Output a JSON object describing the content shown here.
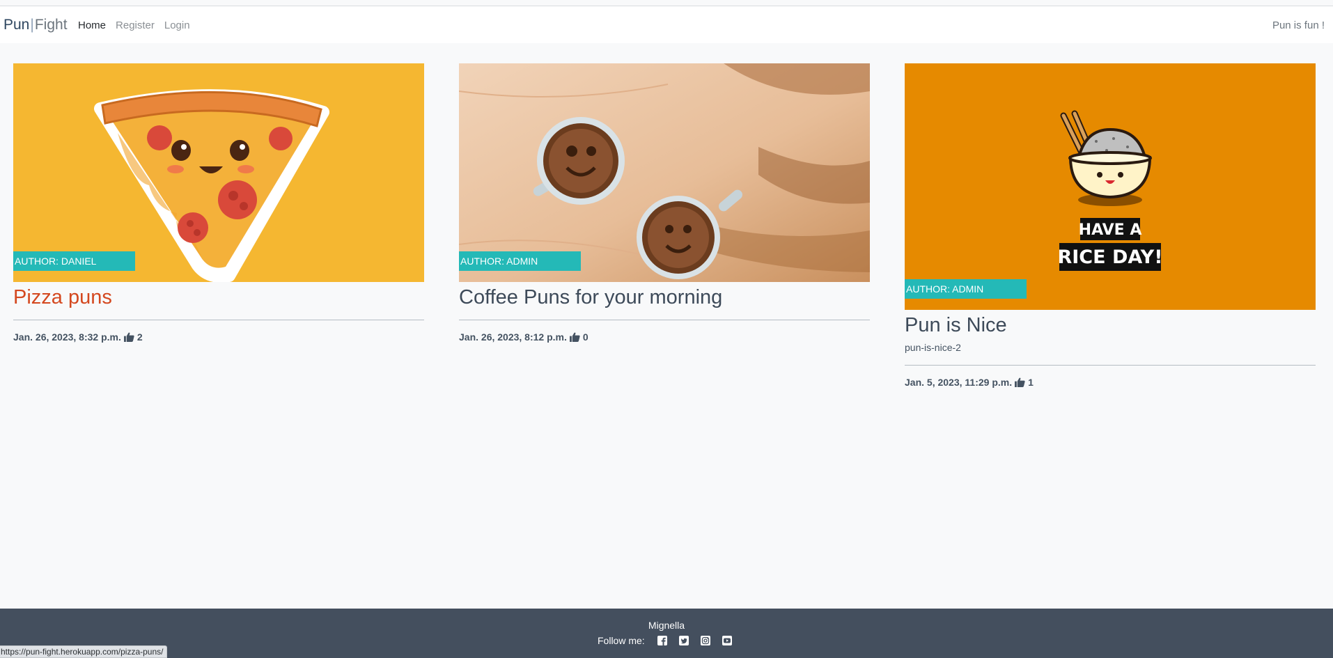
{
  "navbar": {
    "brand_pun": "Pun",
    "brand_sep": "|",
    "brand_fight": "Fight",
    "links": [
      {
        "label": "Home",
        "active": true
      },
      {
        "label": "Register",
        "active": false
      },
      {
        "label": "Login",
        "active": false
      }
    ],
    "tagline": "Pun is fun !"
  },
  "posts": [
    {
      "author": "AUTHOR: DANIEL",
      "title": "Pizza puns",
      "date": "Jan. 26, 2023, 8:32 p.m.",
      "likes": "2",
      "image": "pizza-slice-illustration"
    },
    {
      "author": "AUTHOR: ADMIN",
      "title": "Coffee Puns for your morning",
      "date": "Jan. 26, 2023, 8:12 p.m.",
      "likes": "0",
      "image": "coffee-cups-photo"
    },
    {
      "author": "AUTHOR: ADMIN",
      "title": "Pun is Nice",
      "excerpt": "pun-is-nice-2",
      "date": "Jan. 5, 2023, 11:29 p.m.",
      "likes": "1",
      "image": "rice-bowl-illustration",
      "image_text_1": "HAVE A",
      "image_text_2": "RICE DAY!"
    }
  ],
  "footer": {
    "name": "Mignella",
    "follow_label": "Follow me:",
    "social_icons": [
      "facebook-icon",
      "twitter-icon",
      "instagram-icon",
      "youtube-icon"
    ]
  },
  "status_url": "https://pun-fight.herokuapp.com/pizza-puns/",
  "colors": {
    "badge": "#24b9b7",
    "title_hover": "#d4481f",
    "footer": "#444f5e",
    "pizza_bg": "#f5b731",
    "rice_bg": "#e68a00"
  }
}
